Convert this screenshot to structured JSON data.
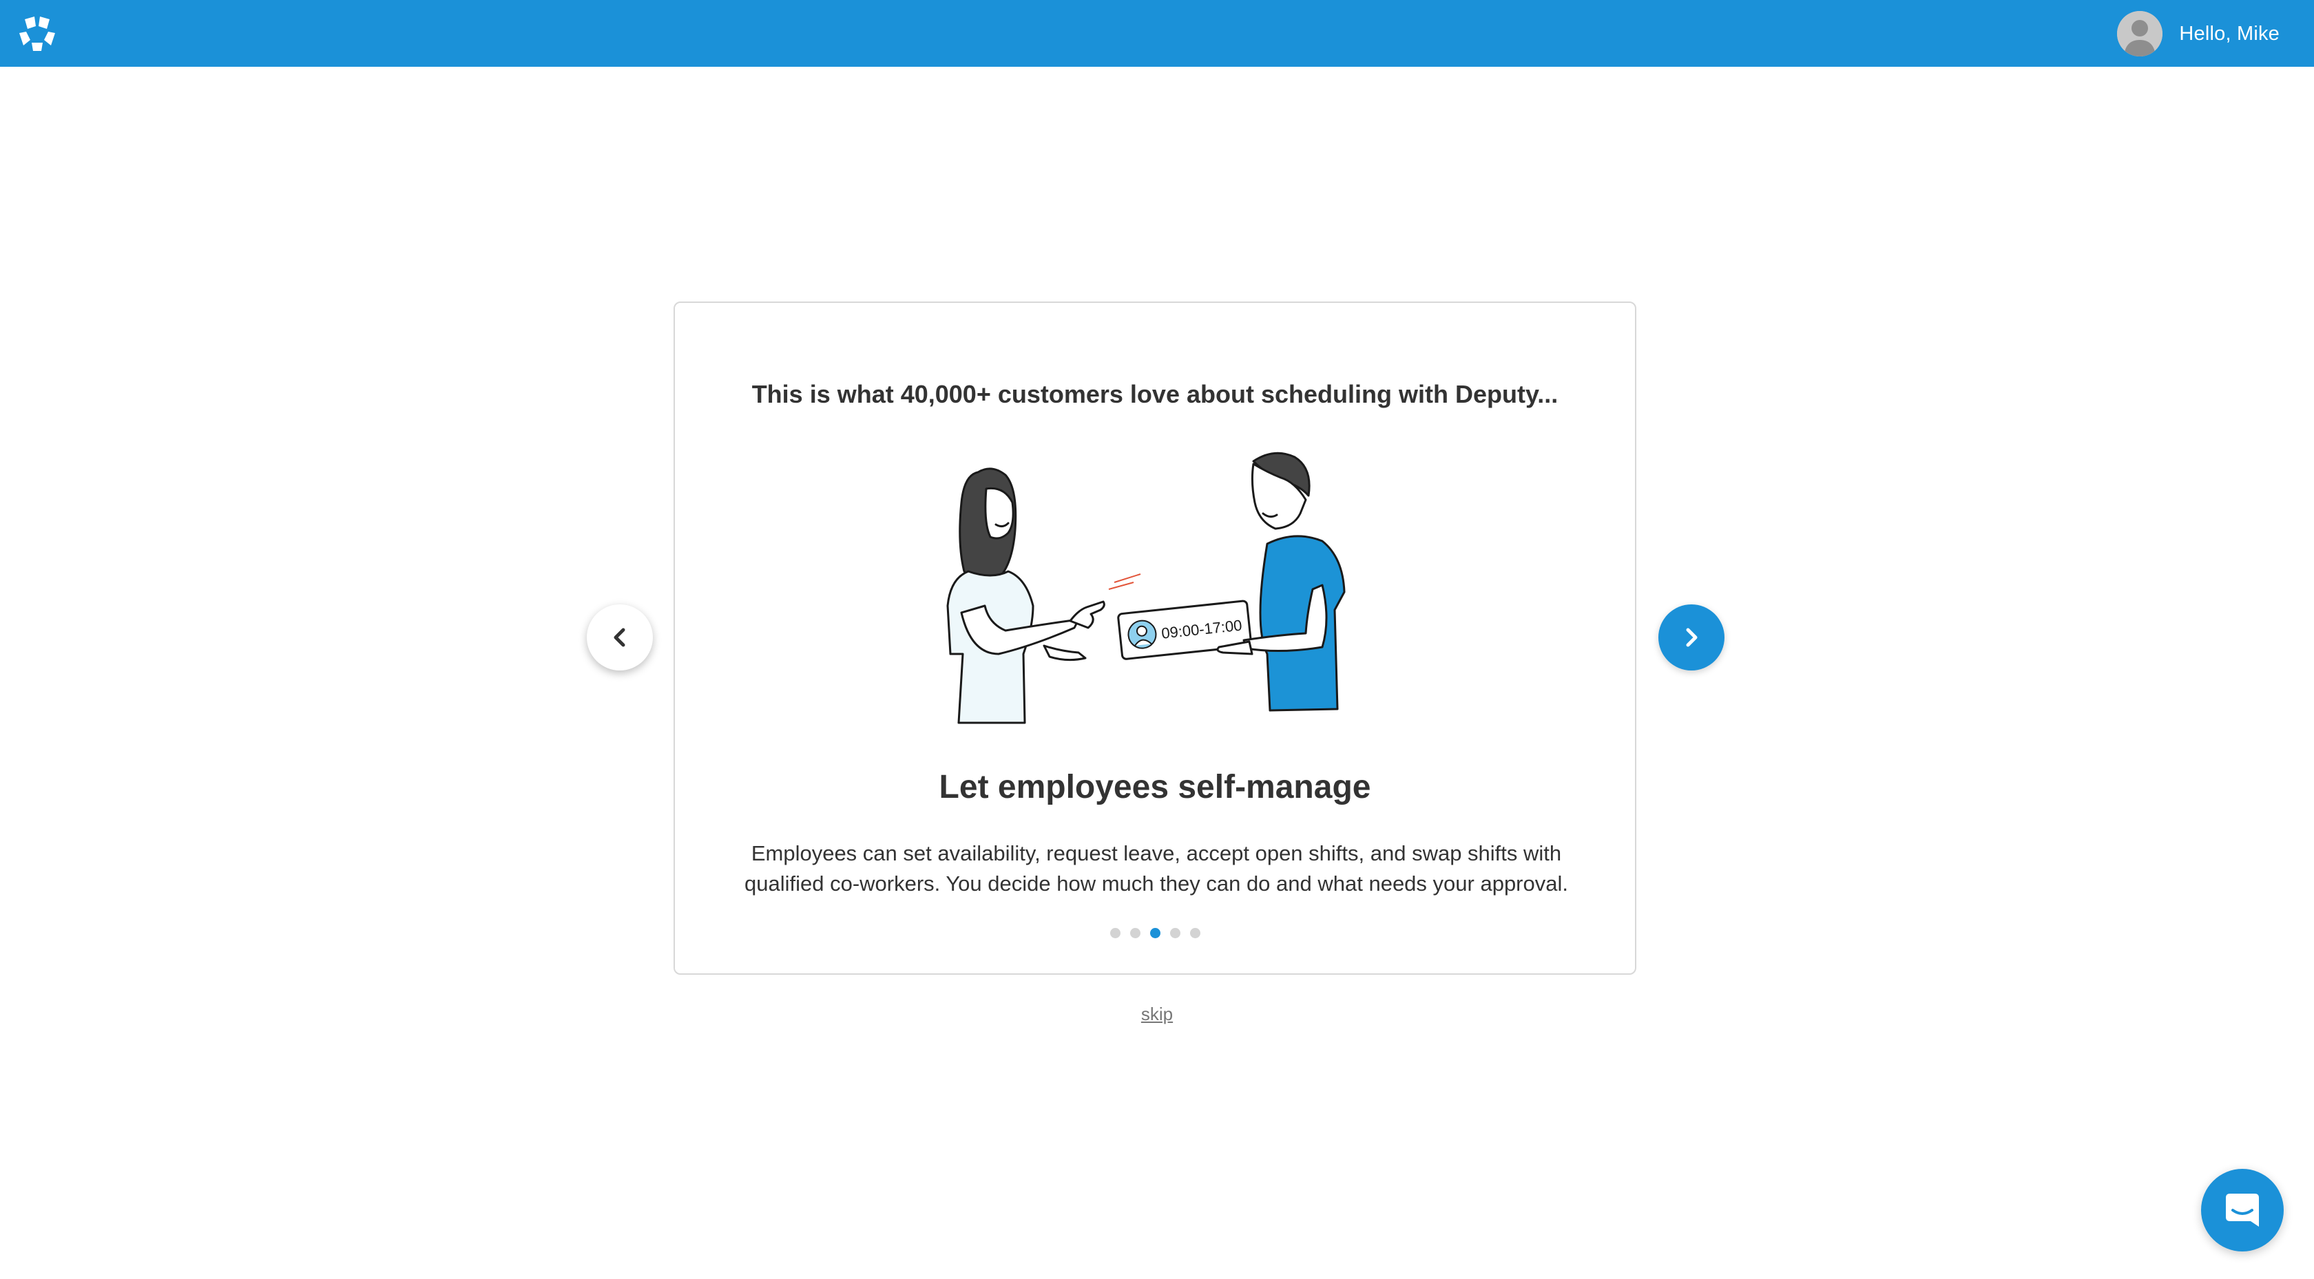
{
  "header": {
    "greeting": "Hello, Mike",
    "logo_icon": "deputy-logo-icon",
    "avatar_icon": "user-avatar-icon",
    "bar_color": "#1b91d8"
  },
  "onboarding": {
    "intro": "This is what 40,000+ customers love about scheduling with Deputy...",
    "illustration": {
      "shift_time": "09:00-17:00"
    },
    "title": "Let employees self-manage",
    "description_line1": "Employees can set availability, request leave, accept open shifts, and swap shifts with",
    "description_line2": "qualified co-workers. You decide how much they can do and what needs your approval.",
    "total_slides": 5,
    "active_slide": 3,
    "prev_icon": "chevron-left-icon",
    "next_icon": "chevron-right-icon",
    "skip_label": "skip",
    "accent_color": "#1b91d8"
  },
  "chat": {
    "icon": "chat-bubble-icon"
  }
}
